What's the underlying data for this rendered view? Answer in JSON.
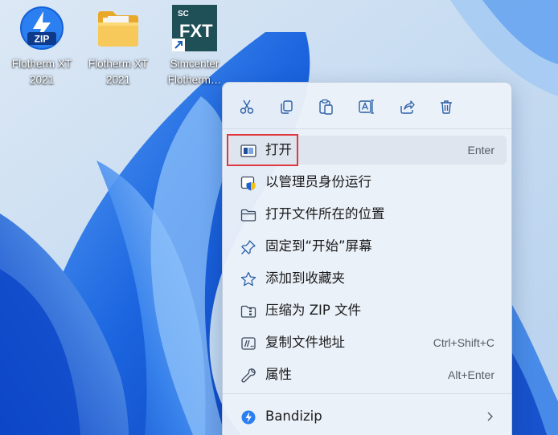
{
  "desktop": {
    "icons": [
      {
        "label_line1": "Flotherm XT",
        "label_line2": "2021",
        "icon": "zip-archive-icon"
      },
      {
        "label_line1": "Flotherm XT",
        "label_line2": "2021",
        "icon": "folder-icon"
      },
      {
        "label_line1": "Simcenter",
        "label_line2": "Flotherm…",
        "icon": "simcenter-fxt-icon",
        "badge_top": "SC",
        "badge_main": "FXT"
      }
    ],
    "zip_badge": "ZIP"
  },
  "context_menu": {
    "toolbar": [
      {
        "name": "cut",
        "icon": "scissors-icon"
      },
      {
        "name": "copy",
        "icon": "copy-icon"
      },
      {
        "name": "paste",
        "icon": "paste-icon"
      },
      {
        "name": "rename",
        "icon": "rename-icon"
      },
      {
        "name": "share",
        "icon": "share-icon"
      },
      {
        "name": "delete",
        "icon": "trash-icon"
      }
    ],
    "items": [
      {
        "label": "打开",
        "shortcut": "Enter",
        "icon": "open-window-icon"
      },
      {
        "label": "以管理员身份运行",
        "shortcut": "",
        "icon": "admin-shield-icon"
      },
      {
        "label": "打开文件所在的位置",
        "shortcut": "",
        "icon": "folder-outline-icon"
      },
      {
        "label": "固定到“开始”屏幕",
        "shortcut": "",
        "icon": "pin-icon"
      },
      {
        "label": "添加到收藏夹",
        "shortcut": "",
        "icon": "star-icon"
      },
      {
        "label": "压缩为 ZIP 文件",
        "shortcut": "",
        "icon": "zip-folder-icon"
      },
      {
        "label": "复制文件地址",
        "shortcut": "Ctrl+Shift+C",
        "icon": "copy-path-icon"
      },
      {
        "label": "属性",
        "shortcut": "Alt+Enter",
        "icon": "wrench-icon"
      },
      {
        "label": "Bandizip",
        "shortcut": "",
        "icon": "bandizip-icon",
        "has_submenu": true
      }
    ]
  },
  "colors": {
    "highlight_border": "#e0383f",
    "menu_bg": "#ecf1f9",
    "wallpaper_blue": "#1f6fe0"
  }
}
